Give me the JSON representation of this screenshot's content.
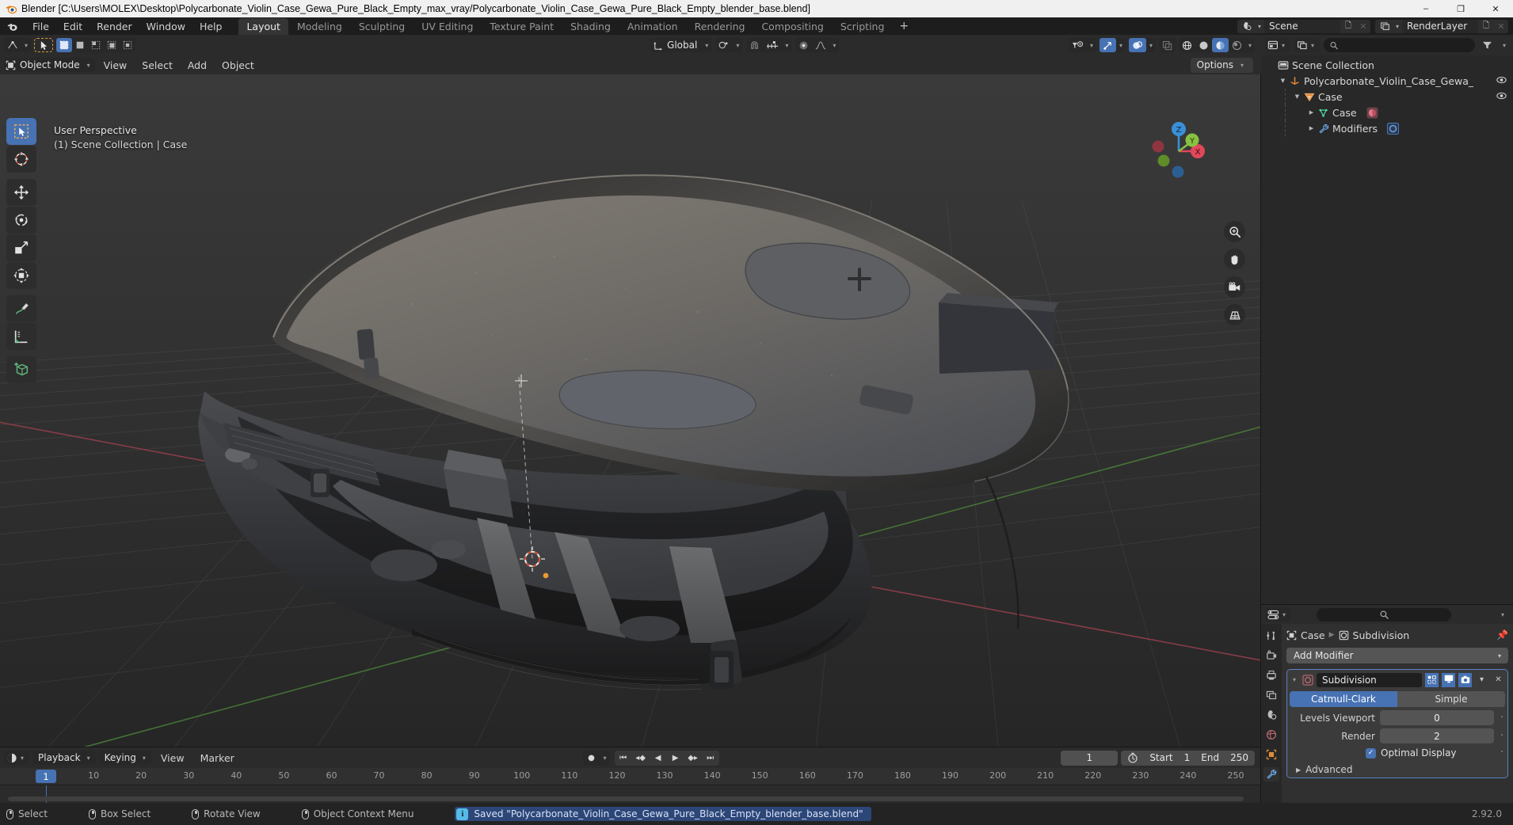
{
  "window": {
    "title": "Blender [C:\\Users\\MOLEX\\Desktop\\Polycarbonate_Violin_Case_Gewa_Pure_Black_Empty_max_vray/Polycarbonate_Violin_Case_Gewa_Pure_Black_Empty_blender_base.blend]",
    "minimize": "–",
    "maximize": "❐",
    "close": "✕"
  },
  "topbar": {
    "menus": [
      "File",
      "Edit",
      "Render",
      "Window",
      "Help"
    ],
    "workspaces": [
      {
        "label": "Layout",
        "active": true
      },
      {
        "label": "Modeling",
        "active": false
      },
      {
        "label": "Sculpting",
        "active": false
      },
      {
        "label": "UV Editing",
        "active": false
      },
      {
        "label": "Texture Paint",
        "active": false
      },
      {
        "label": "Shading",
        "active": false
      },
      {
        "label": "Animation",
        "active": false
      },
      {
        "label": "Rendering",
        "active": false
      },
      {
        "label": "Compositing",
        "active": false
      },
      {
        "label": "Scripting",
        "active": false
      }
    ],
    "add_workspace": "+",
    "scene_name": "Scene",
    "view_layer_name": "RenderLayer"
  },
  "viewport": {
    "mode": "Object Mode",
    "menus": [
      "View",
      "Select",
      "Add",
      "Object"
    ],
    "transform_orientation": "Global",
    "options_label": "Options",
    "overlay_line1": "User Perspective",
    "overlay_line2": "(1) Scene Collection | Case",
    "gizmo_axes": [
      "X",
      "Y",
      "Z"
    ],
    "gizmo_colors": {
      "x": "#e0485a",
      "y": "#88c040",
      "z": "#3b8fd8"
    },
    "tools": [
      {
        "name": "tweak-select-box",
        "active": true
      },
      {
        "name": "cursor",
        "active": false
      },
      {
        "name": "move",
        "active": false
      },
      {
        "name": "rotate",
        "active": false
      },
      {
        "name": "scale",
        "active": false
      },
      {
        "name": "transform",
        "active": false
      },
      {
        "name": "annotate",
        "active": false
      },
      {
        "name": "measure",
        "active": false
      },
      {
        "name": "add-cube",
        "active": false
      }
    ],
    "nav_buttons": [
      "zoom",
      "pan",
      "camera-view",
      "toggle-perspective"
    ]
  },
  "outliner": {
    "search_placeholder": "",
    "rows": [
      {
        "label": "Scene Collection",
        "depth": 0,
        "icon": "collection-icon",
        "expand": "",
        "eye": false
      },
      {
        "label": "Polycarbonate_Violin_Case_Gewa_Pure_Blac",
        "depth": 1,
        "icon": "empty-axis-icon",
        "expand": "▼",
        "eye": true
      },
      {
        "label": "Case",
        "depth": 2,
        "icon": "object-mesh-icon",
        "expand": "▼",
        "eye": true
      },
      {
        "label": "Case",
        "depth": 3,
        "icon": "mesh-data-icon",
        "expand": "▶",
        "eye": false,
        "badge": "material-icon"
      },
      {
        "label": "Modifiers",
        "depth": 3,
        "icon": "wrench-icon",
        "expand": "▶",
        "eye": false,
        "badge": "subsurf-icon"
      }
    ]
  },
  "properties": {
    "breadcrumb": [
      "Case",
      "Subdivision"
    ],
    "add_modifier": "Add Modifier",
    "modifier": {
      "name": "Subdivision",
      "type_options": [
        "Catmull-Clark",
        "Simple"
      ],
      "type_selected": "Catmull-Clark",
      "levels_viewport_label": "Levels Viewport",
      "levels_viewport_value": "0",
      "render_label": "Render",
      "render_value": "2",
      "optimal_display_label": "Optimal Display",
      "optimal_display_checked": true,
      "advanced_label": "Advanced"
    },
    "tabs": [
      "tool-icon",
      "render-icon",
      "output-icon",
      "view-layer-icon",
      "scene-icon",
      "world-icon",
      "object-icon",
      "modifier-icon"
    ]
  },
  "timeline": {
    "playback_label": "Playback",
    "keying_label": "Keying",
    "view_label": "View",
    "marker_label": "Marker",
    "current_frame": "1",
    "start_label": "Start",
    "start_value": "1",
    "end_label": "End",
    "end_value": "250",
    "ticks": [
      "1",
      "10",
      "20",
      "30",
      "40",
      "50",
      "60",
      "70",
      "80",
      "90",
      "100",
      "110",
      "120",
      "130",
      "140",
      "150",
      "160",
      "170",
      "180",
      "190",
      "200",
      "210",
      "220",
      "230",
      "240",
      "250"
    ],
    "playhead_frame": "1"
  },
  "statusbar": {
    "items": [
      {
        "label": "Select",
        "mouse": "left"
      },
      {
        "label": "Box Select",
        "mouse": "left-drag"
      },
      {
        "label": "Rotate View",
        "mouse": "middle"
      },
      {
        "label": "Object Context Menu",
        "mouse": "right"
      }
    ],
    "report_icon": "i",
    "report_text": "Saved \"Polycarbonate_Violin_Case_Gewa_Pure_Black_Empty_blender_base.blend\"",
    "version": "2.92.0"
  }
}
